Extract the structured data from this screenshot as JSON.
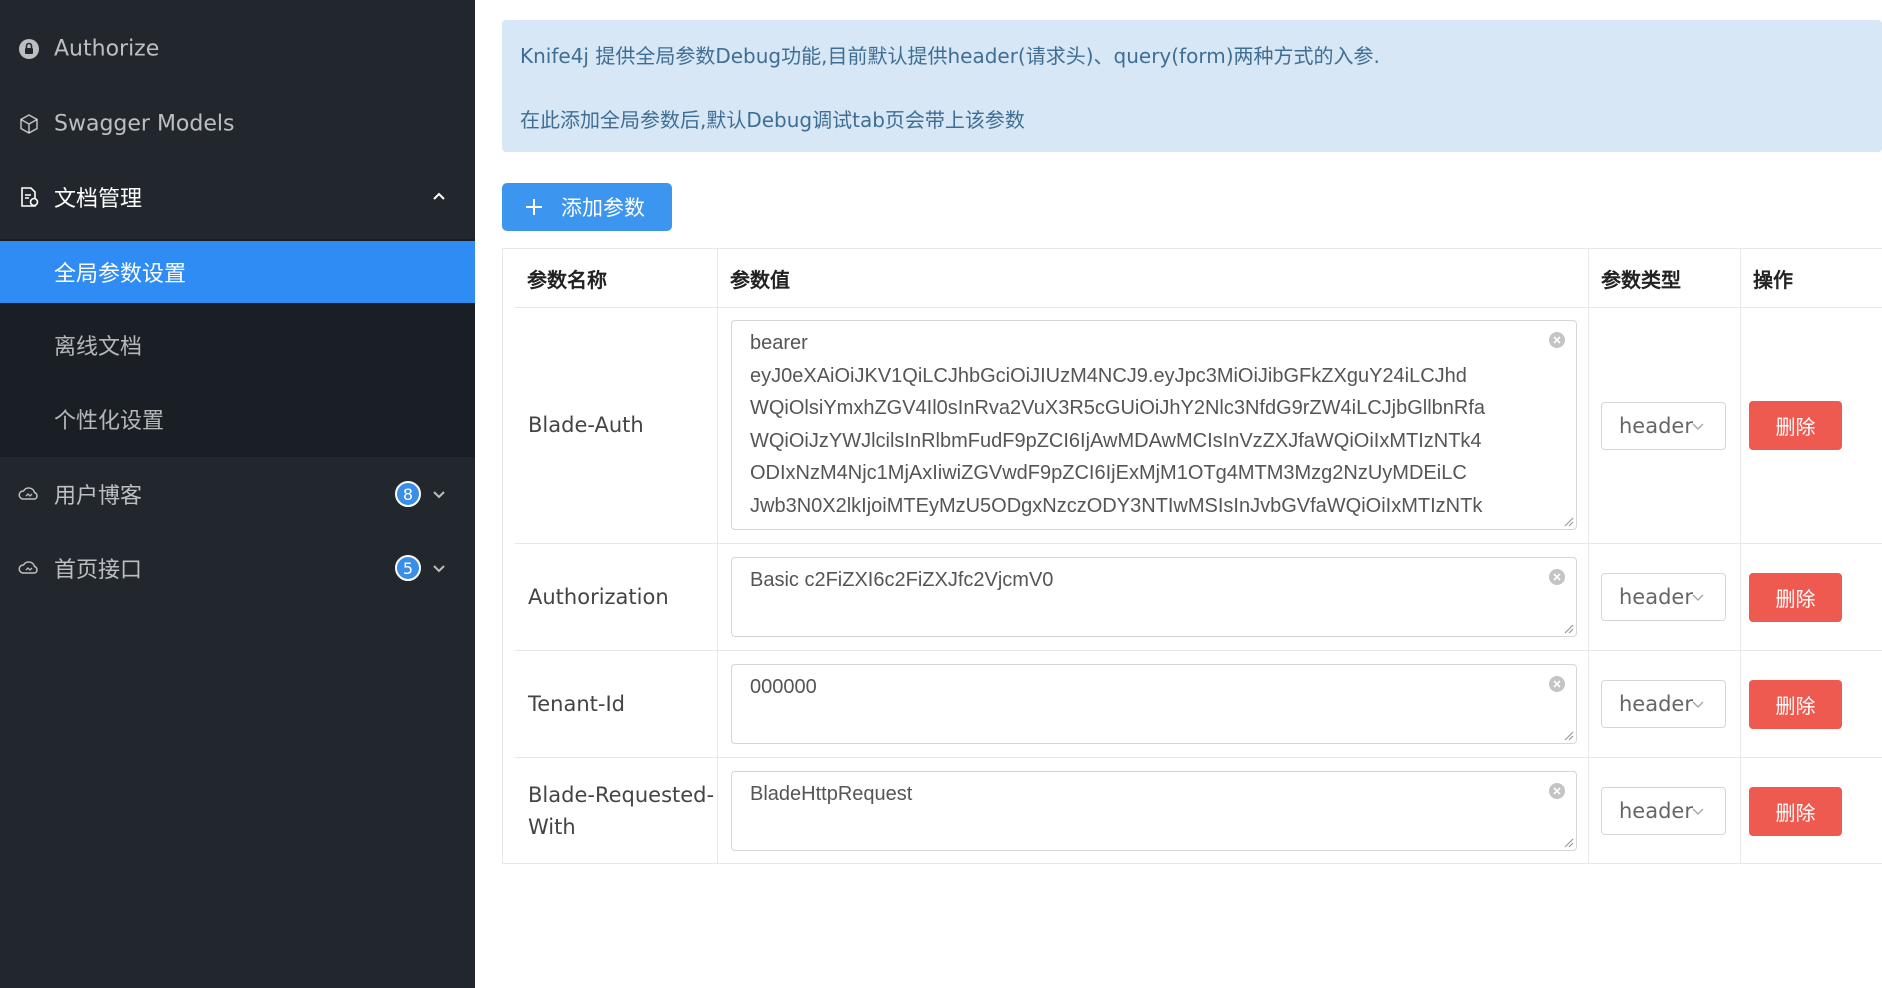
{
  "sidebar": {
    "items": [
      {
        "label": "Authorize",
        "icon": "lock-icon"
      },
      {
        "label": "Swagger Models",
        "icon": "cube-icon"
      },
      {
        "label": "文档管理",
        "icon": "document-icon"
      },
      {
        "label": "全局参数设置"
      },
      {
        "label": "离线文档"
      },
      {
        "label": "个性化设置"
      },
      {
        "label": "用户博客",
        "icon": "cloud-icon",
        "badge": "8"
      },
      {
        "label": "首页接口",
        "icon": "cloud-icon",
        "badge": "5"
      }
    ]
  },
  "info": {
    "line1": "Knife4j 提供全局参数Debug功能,目前默认提供header(请求头)、query(form)两种方式的入参.",
    "line2": "在此添加全局参数后,默认Debug调试tab页会带上该参数"
  },
  "add_button": {
    "label": "添加参数"
  },
  "table": {
    "headers": [
      "参数名称",
      "参数值",
      "参数类型",
      "操作"
    ],
    "rows": [
      {
        "name": "Blade-Auth",
        "value_lines": [
          "bearer",
          "eyJ0eXAiOiJKV1QiLCJhbGciOiJIUzM4NCJ9.eyJpc3MiOiJibGFkZXguY24iLCJhd",
          "WQiOlsiYmxhZGV4Il0sInRva2VuX3R5cGUiOiJhY2Nlc3NfdG9rZW4iLCJjbGllbnRfa",
          "WQiOiJzYWJlcilsInRlbmFudF9pZCI6IjAwMDAwMCIsInVzZXJfaWQiOiIxMTIzNTk4",
          "ODIxNzM4Njc1MjAxIiwiZGVwdF9pZCI6IjExMjM1OTg4MTM3Mzg2NzUyMDEiLC",
          "Jwb3N0X2lkIjoiMTEyMzU5ODgxNzczODY3NTIwMSIsInJvbGVfaWQiOiIxMTIzNTk"
        ],
        "type": "header",
        "action": "删除"
      },
      {
        "name": "Authorization",
        "value_lines": [
          "Basic c2FiZXI6c2FiZXJfc2VjcmV0"
        ],
        "type": "header",
        "action": "删除"
      },
      {
        "name": "Tenant-Id",
        "value_lines": [
          "000000"
        ],
        "type": "header",
        "action": "删除"
      },
      {
        "name_lines": [
          "Blade-Requested-",
          "With"
        ],
        "value_lines": [
          "BladeHttpRequest"
        ],
        "type": "header",
        "action": "删除"
      }
    ]
  },
  "colors": {
    "sidebar_bg": "#22272e",
    "submenu_bg": "#1a1f26",
    "active_bg": "#2f8cf5",
    "info_bg": "#d8e7f5",
    "info_text": "#3f6e95",
    "primary": "#3c95ee",
    "danger": "#ee5a4f"
  }
}
